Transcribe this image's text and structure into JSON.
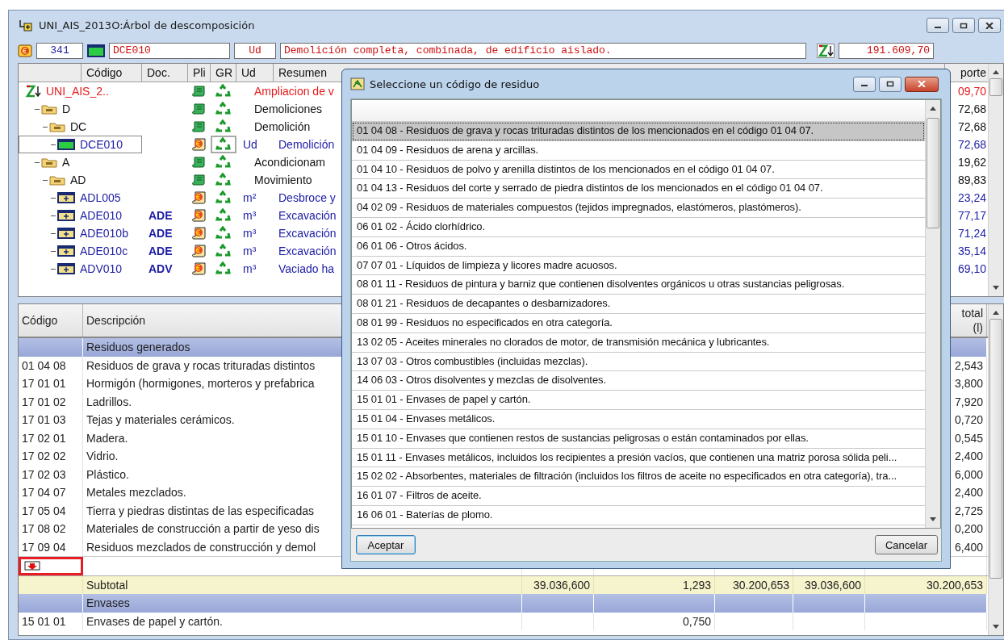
{
  "window": {
    "title": "UNI_AIS_2013O:Árbol de descomposición"
  },
  "toolbar": {
    "count": "341",
    "code": "DCE010",
    "unit": "Ud",
    "description": "Demolición completa, combinada, de edificio aislado.",
    "amount": "191.609,70"
  },
  "tree": {
    "headers": {
      "code": "Código",
      "doc": "Doc.",
      "pli": "Pli",
      "gr": "GR",
      "ud": "Ud",
      "summary": "Resumen",
      "amount": "porte"
    },
    "rows": [
      {
        "kind": "root",
        "code": "UNI_AIS_2..",
        "summary": "Ampliacion de v",
        "amount": "09,70",
        "selected": false,
        "children": [
          {
            "kind": "chapter",
            "code": "D",
            "summary": "Demoliciones",
            "amount": "72,68",
            "selected": false,
            "children": [
              {
                "kind": "chapter",
                "code": "DC",
                "summary": "Demolición",
                "amount": "72,68",
                "selected": false,
                "children": [
                  {
                    "kind": "work",
                    "code": "DCE010",
                    "ud": "Ud",
                    "summary": "Demolición",
                    "amount": "72,68",
                    "selected": true
                  }
                ]
              }
            ]
          },
          {
            "kind": "chapter",
            "code": "A",
            "summary": "Acondicionam",
            "amount": "19,62",
            "selected": false,
            "children": [
              {
                "kind": "chapter",
                "code": "AD",
                "summary": "Movimiento",
                "amount": "89,83",
                "selected": false,
                "children": [
                  {
                    "kind": "unit",
                    "code": "ADL005",
                    "ud": "m²",
                    "summary": "Desbroce y",
                    "amount": "23,24",
                    "selected": false
                  },
                  {
                    "kind": "unit",
                    "code": "ADE010",
                    "doc": "ADE",
                    "ud": "m³",
                    "summary": "Excavación",
                    "amount": "77,17",
                    "selected": false
                  },
                  {
                    "kind": "unit",
                    "code": "ADE010b",
                    "doc": "ADE",
                    "ud": "m³",
                    "summary": "Excavación",
                    "amount": "71,24",
                    "selected": false
                  },
                  {
                    "kind": "unit",
                    "code": "ADE010c",
                    "doc": "ADE",
                    "ud": "m³",
                    "summary": "Excavación",
                    "amount": "35,14",
                    "selected": false
                  },
                  {
                    "kind": "unit",
                    "code": "ADV010",
                    "doc": "ADV",
                    "ud": "m³",
                    "summary": "Vaciado ha",
                    "amount": "69,10",
                    "selected": false
                  }
                ]
              }
            ]
          }
        ]
      }
    ]
  },
  "waste_table": {
    "headers": {
      "code": "Código",
      "description": "Descripción",
      "total": [
        "total",
        "(l)"
      ]
    },
    "rows": [
      {
        "kind": "group",
        "description": "Residuos generados"
      },
      {
        "kind": "item",
        "code": "01 04 08",
        "description": "Residuos de grava y rocas trituradas distintos",
        "column_7": "2,543"
      },
      {
        "kind": "item",
        "code": "17 01 01",
        "description": "Hormigón (hormigones, morteros y prefabrica",
        "column_7": "3,800"
      },
      {
        "kind": "item",
        "code": "17 01 02",
        "description": "Ladrillos.",
        "column_7": "7,920"
      },
      {
        "kind": "item",
        "code": "17 01 03",
        "description": "Tejas y materiales cerámicos.",
        "column_7": "0,720"
      },
      {
        "kind": "item",
        "code": "17 02 01",
        "description": "Madera.",
        "column_7": "0,545"
      },
      {
        "kind": "item",
        "code": "17 02 02",
        "description": "Vidrio.",
        "column_7": "2,400"
      },
      {
        "kind": "item",
        "code": "17 02 03",
        "description": "Plástico.",
        "column_7": "6,000"
      },
      {
        "kind": "item",
        "code": "17 04 07",
        "description": "Metales mezclados.",
        "column_7": "2,400"
      },
      {
        "kind": "item",
        "code": "17 05 04",
        "description": "Tierra y piedras distintas de las especificadas",
        "column_7": "2,725"
      },
      {
        "kind": "item",
        "code": "17 08 02",
        "description": "Materiales de construcción a partir de yeso dis",
        "column_7": "0,200"
      },
      {
        "kind": "item",
        "code": "17 09 04",
        "description": "Residuos mezclados de construcción y demol",
        "column_7": "6,400"
      },
      {
        "kind": "add",
        "highlighted": true
      },
      {
        "kind": "subtotal",
        "description": "Subtotal",
        "column_3": "39.036,600",
        "column_4": "1,293",
        "column_5": "30.200,653",
        "column_6": "39.036,600",
        "column_7": "30.200,653"
      },
      {
        "kind": "group",
        "description": "Envases"
      },
      {
        "kind": "item",
        "code": "15 01 01",
        "description": "Envases de papel y cartón.",
        "column_4": "0,750"
      }
    ]
  },
  "dialog": {
    "title": "Seleccione un código de residuo",
    "items": [
      {
        "text": "01 04 08 - Residuos de grava y rocas trituradas distintos de los mencionados en el código 01 04 07.",
        "selected": true
      },
      {
        "text": "01 04 09 - Residuos de arena y arcillas.",
        "selected": false
      },
      {
        "text": "01 04 10 - Residuos de polvo y arenilla distintos de los mencionados en el código 01 04 07.",
        "selected": false
      },
      {
        "text": "01 04 13 - Residuos del corte y serrado de piedra distintos de los mencionados en el código 01 04 07.",
        "selected": false
      },
      {
        "text": "04 02 09 - Residuos de materiales compuestos (tejidos impregnados, elastómeros, plastómeros).",
        "selected": false
      },
      {
        "text": "06 01 02 - Ácido clorhídrico.",
        "selected": false
      },
      {
        "text": "06 01 06 - Otros ácidos.",
        "selected": false
      },
      {
        "text": "07 07 01 - Líquidos de limpieza y licores madre acuosos.",
        "selected": false
      },
      {
        "text": "08 01 11 - Residuos de pintura y barniz que contienen disolventes orgánicos u otras sustancias peligrosas.",
        "selected": false
      },
      {
        "text": "08 01 21 - Residuos de decapantes o desbarnizadores.",
        "selected": false
      },
      {
        "text": "08 01 99 - Residuos no especificados en otra categoría.",
        "selected": false
      },
      {
        "text": "13 02 05 - Aceites minerales no clorados de motor, de transmisión mecánica y lubricantes.",
        "selected": false
      },
      {
        "text": "13 07 03 - Otros combustibles (incluidas mezclas).",
        "selected": false
      },
      {
        "text": "14 06 03 - Otros disolventes y mezclas de disolventes.",
        "selected": false
      },
      {
        "text": "15 01 01 - Envases de papel y cartón.",
        "selected": false
      },
      {
        "text": "15 01 04 - Envases metálicos.",
        "selected": false
      },
      {
        "text": "15 01 10 - Envases que contienen restos de sustancias peligrosas o están contaminados por ellas.",
        "selected": false
      },
      {
        "text": "15 01 11 - Envases metálicos, incluidos los recipientes a presión vacíos, que contienen una matriz porosa sólida peli...",
        "selected": false
      },
      {
        "text": "15 02 02 - Absorbentes, materiales de filtración (incluidos los filtros de aceite no especificados en otra categoría), tra...",
        "selected": false
      },
      {
        "text": "16 01 07 - Filtros de aceite.",
        "selected": false
      },
      {
        "text": "16 06 01 - Baterías de plomo.",
        "selected": false
      }
    ],
    "buttons": [
      {
        "label": "Aceptar",
        "focused": true
      },
      {
        "label": "Cancelar",
        "focused": false
      }
    ]
  }
}
